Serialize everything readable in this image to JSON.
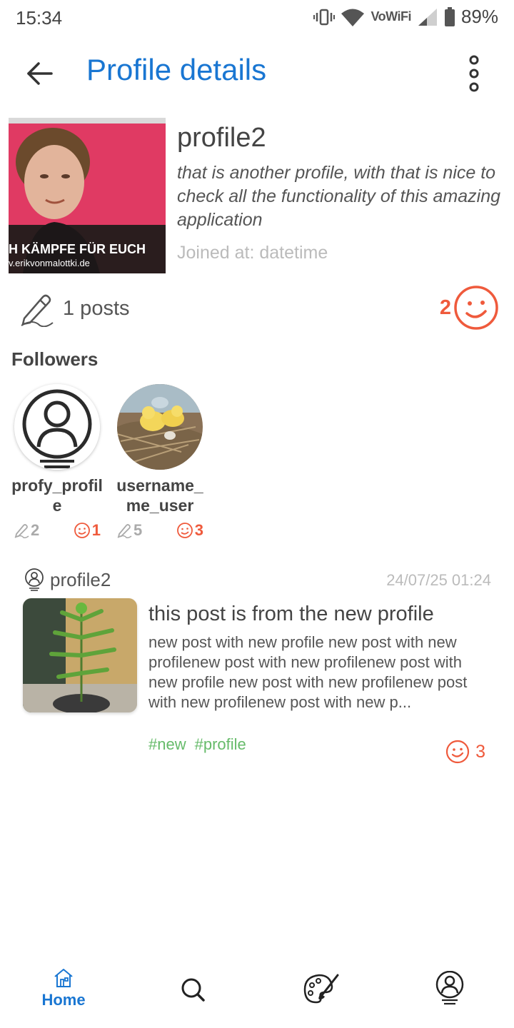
{
  "status_bar": {
    "time": "15:34",
    "network_label": "VoWiFi",
    "battery": "89%"
  },
  "app_bar": {
    "title": "Profile details",
    "back_icon": "arrow-left-icon",
    "menu_icon": "more-vertical-icon",
    "title_color": "#1976d2"
  },
  "profile": {
    "name": "profile2",
    "bio": "that is another profile, with that is nice to check all the functionality of this amazing application",
    "joined": "Joined at: datetime",
    "photo_text_line1": "H KÄMPFE FÜR EUCH",
    "photo_text_line2": "v.erikvonmalottki.de",
    "posts_label": "1 posts",
    "smile_count": "2"
  },
  "followers": {
    "heading": "Followers",
    "items": [
      {
        "name": "profy_profile",
        "posts": "2",
        "smiles": "1"
      },
      {
        "name": "username_me_user",
        "posts": "5",
        "smiles": "3"
      }
    ]
  },
  "post": {
    "author": "profile2",
    "date": "24/07/25 01:24",
    "title": "this post is from the new profile",
    "body": "new post with new profile new post with new profilenew post with new profilenew post with new profile new post with new profilenew post with new profilenew post with new p...",
    "tags": [
      "#new",
      "#profile"
    ],
    "reactions": "3"
  },
  "bottom_nav": {
    "home_label": "Home",
    "items": [
      "home-icon",
      "search-icon",
      "palette-icon",
      "profile-icon"
    ]
  },
  "colors": {
    "accent": "#1976d2",
    "smile": "#ef5a3c",
    "tag": "#66bb6a",
    "muted": "#bbbbbb"
  }
}
